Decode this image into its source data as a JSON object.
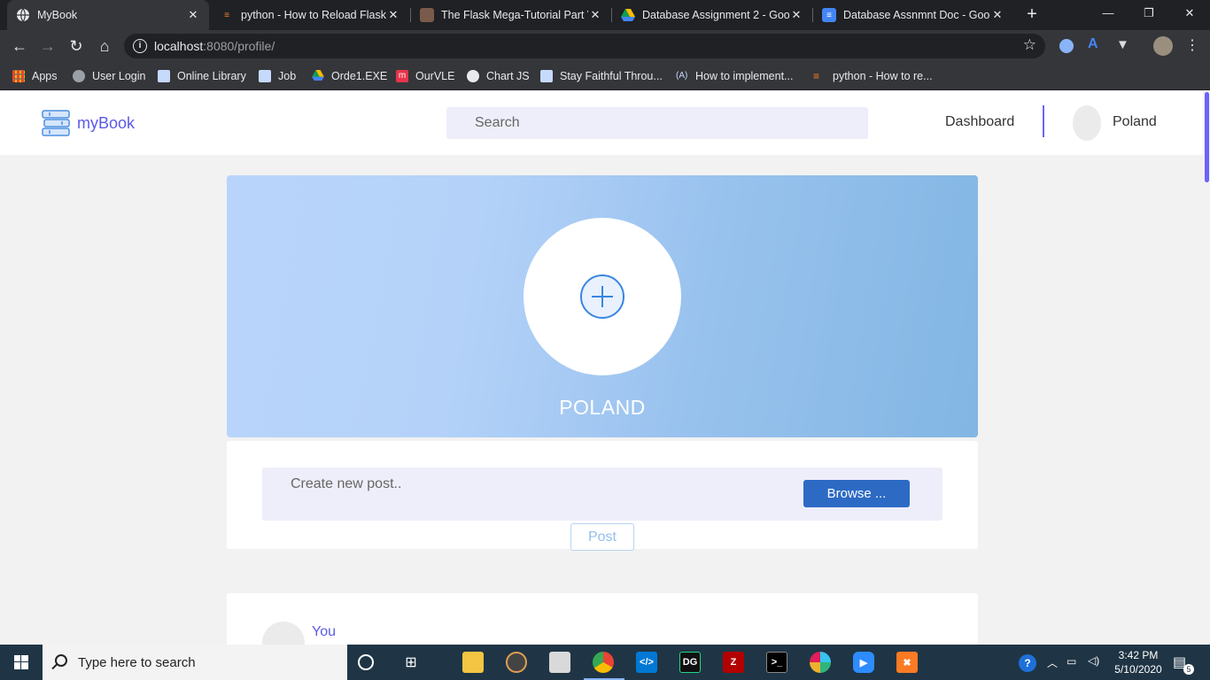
{
  "browser": {
    "tabs": [
      {
        "title": "MyBook",
        "active": true,
        "icon": "globe-icon"
      },
      {
        "title": "python - How to Reload Flask-",
        "active": false,
        "icon": "stackoverflow-icon"
      },
      {
        "title": "The Flask Mega-Tutorial Part V",
        "active": false,
        "icon": "blog-icon"
      },
      {
        "title": "Database Assignment 2 - Goog",
        "active": false,
        "icon": "google-drive-icon"
      },
      {
        "title": "Database Assnmnt Doc - Goog",
        "active": false,
        "icon": "google-docs-icon"
      }
    ],
    "url_host": "localhost",
    "url_rest": ":8080/profile/",
    "bookmarks": [
      {
        "label": "Apps",
        "icon": "apps-grid-icon"
      },
      {
        "label": "User Login",
        "icon": "bookmark-icon"
      },
      {
        "label": "Online Library",
        "icon": "bookmark-icon"
      },
      {
        "label": "Job",
        "icon": "bookmark-icon"
      },
      {
        "label": "Orde1.EXE",
        "icon": "google-drive-icon"
      },
      {
        "label": "OurVLE",
        "icon": "moodle-icon"
      },
      {
        "label": "Chart JS",
        "icon": "globe-icon"
      },
      {
        "label": "Stay Faithful Throu...",
        "icon": "bookmark-icon"
      },
      {
        "label": "How to implement...",
        "icon": "code-icon"
      },
      {
        "label": "python - How to re...",
        "icon": "stackoverflow-icon"
      }
    ]
  },
  "app": {
    "brand": "myBook",
    "search_placeholder": "Search",
    "nav_dashboard": "Dashboard",
    "nav_user": "Poland",
    "profile_name": "POLAND",
    "composer_placeholder": "Create new post..",
    "browse_label": "Browse ...",
    "post_label": "Post",
    "feed_author": "You",
    "accent_color": "#6c63ff",
    "brand_color": "#5a5ae8"
  },
  "taskbar": {
    "search_placeholder": "Type here to search",
    "time": "3:42 PM",
    "date": "5/10/2020",
    "notification_count": "5"
  }
}
